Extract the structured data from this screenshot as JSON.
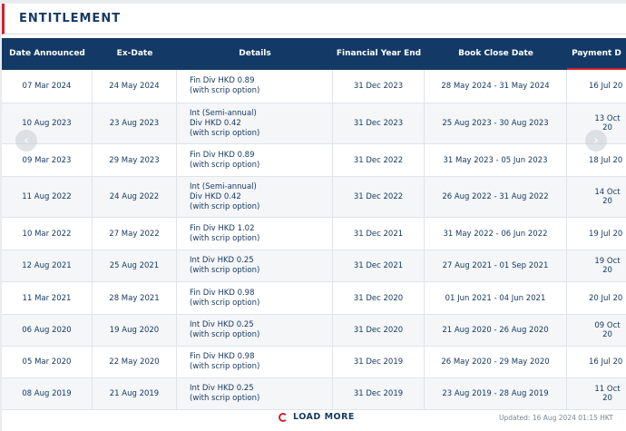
{
  "section": {
    "title": "ENTITLEMENT"
  },
  "table": {
    "columns": [
      "Date Announced",
      "Ex-Date",
      "Details",
      "Financial Year End",
      "Book Close Date",
      "Payment D"
    ],
    "rows": [
      {
        "announced": "07 Mar 2024",
        "exdate": "24 May 2024",
        "details": "Fin Div HKD 0.89\n(with scrip option)",
        "fye": "31 Dec 2023",
        "bookclose": "28 May 2024 - 31 May 2024",
        "payment": "16 Jul 20"
      },
      {
        "announced": "10 Aug 2023",
        "exdate": "23 Aug 2023",
        "details": "Int (Semi-annual)\nDiv HKD 0.42\n(with scrip option)",
        "fye": "31 Dec 2023",
        "bookclose": "25 Aug 2023 - 30 Aug 2023",
        "payment": "13 Oct 20"
      },
      {
        "announced": "09 Mar 2023",
        "exdate": "29 May 2023",
        "details": "Fin Div HKD 0.89\n(with scrip option)",
        "fye": "31 Dec 2022",
        "bookclose": "31 May 2023 - 05 Jun 2023",
        "payment": "18 Jul 20"
      },
      {
        "announced": "11 Aug 2022",
        "exdate": "24 Aug 2022",
        "details": "Int (Semi-annual)\nDiv HKD 0.42\n(with scrip option)",
        "fye": "31 Dec 2022",
        "bookclose": "26 Aug 2022 - 31 Aug 2022",
        "payment": "14 Oct 20"
      },
      {
        "announced": "10 Mar 2022",
        "exdate": "27 May 2022",
        "details": "Fin Div HKD 1.02\n(with scrip option)",
        "fye": "31 Dec 2021",
        "bookclose": "31 May 2022 - 06 Jun 2022",
        "payment": "19 Jul 20"
      },
      {
        "announced": "12 Aug 2021",
        "exdate": "25 Aug 2021",
        "details": "Int Div HKD 0.25\n(with scrip option)",
        "fye": "31 Dec 2021",
        "bookclose": "27 Aug 2021 - 01 Sep 2021",
        "payment": "19 Oct 20"
      },
      {
        "announced": "11 Mar 2021",
        "exdate": "28 May 2021",
        "details": "Fin Div HKD 0.98\n(with scrip option)",
        "fye": "31 Dec 2020",
        "bookclose": "01 Jun 2021 - 04 Jun 2021",
        "payment": "20 Jul 20"
      },
      {
        "announced": "06 Aug 2020",
        "exdate": "19 Aug 2020",
        "details": "Int Div HKD 0.25\n(with scrip option)",
        "fye": "31 Dec 2020",
        "bookclose": "21 Aug 2020 - 26 Aug 2020",
        "payment": "09 Oct 20"
      },
      {
        "announced": "05 Mar 2020",
        "exdate": "22 May 2020",
        "details": "Fin Div HKD 0.98\n(with scrip option)",
        "fye": "31 Dec 2019",
        "bookclose": "26 May 2020 - 29 May 2020",
        "payment": "16 Jul 20"
      },
      {
        "announced": "08 Aug 2019",
        "exdate": "21 Aug 2019",
        "details": "Int Div HKD 0.25\n(with scrip option)",
        "fye": "31 Dec 2019",
        "bookclose": "23 Aug 2019 - 28 Aug 2019",
        "payment": "11 Oct 20"
      }
    ]
  },
  "footer": {
    "load_more": "LOAD MORE",
    "updated": "Updated: 16 Aug 2024 01:15 HKT"
  },
  "colors": {
    "header_bg": "#133a66",
    "accent": "#d2212f",
    "text": "#173a63"
  },
  "icons": {
    "prev": "chevron-left-icon",
    "next": "chevron-right-icon",
    "load": "refresh-icon"
  }
}
